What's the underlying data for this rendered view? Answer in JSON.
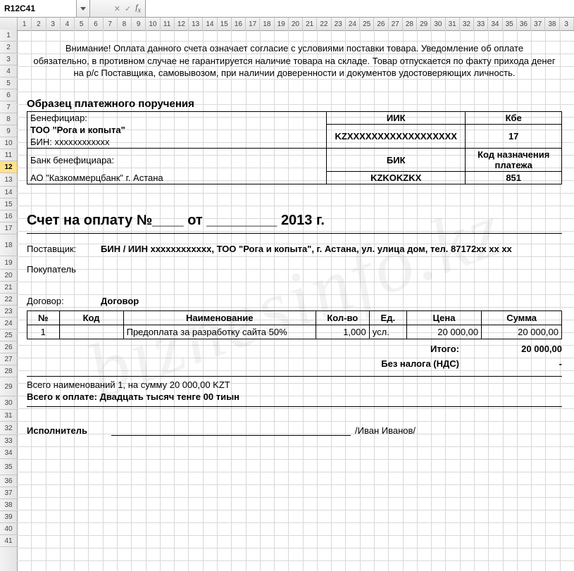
{
  "namebox": "R12C41",
  "formula": "",
  "col_headers": [
    "1",
    "2",
    "3",
    "4",
    "5",
    "6",
    "7",
    "8",
    "9",
    "10",
    "11",
    "12",
    "13",
    "14",
    "15",
    "16",
    "17",
    "18",
    "19",
    "20",
    "21",
    "22",
    "23",
    "24",
    "25",
    "26",
    "27",
    "28",
    "29",
    "30",
    "31",
    "32",
    "33",
    "34",
    "35",
    "36",
    "37",
    "38",
    "3"
  ],
  "row_headers_count": 41,
  "selected_row": 12,
  "warning": {
    "line1": "Внимание! Оплата данного счета означает согласие с условиями поставки товара. Уведомление об оплате",
    "line2": "обязательно, в противном случае не гарантируется наличие товара на складе. Товар отпускается по факту  прихода денег на р/с Поставщика, самовывозом, при наличии доверенности и документов удостоверяющих личность."
  },
  "sample_header": "Образец платежного поручения",
  "bene": {
    "beneficiary_label": "Бенефициар:",
    "iik_label": "ИИК",
    "kbe_label": "Кбе",
    "company": "ТОО \"Рога и копыта\"",
    "iik_value": "KZXXXXXXXXXXXXXXXXXX",
    "kbe_value": "17",
    "bin": "БИН: xxxxxxxxxxxx",
    "bank_label": "Банк бенефициара:",
    "bik_label": "БИК",
    "knp_label": "Код назначения платежа",
    "bank_name": "АО \"Казкоммерцбанк\" г. Астана",
    "bik_value": "KZKOKZKX",
    "knp_value": "851"
  },
  "invoice_title": "Счет на оплату №____  от _________  2013 г.",
  "supplier": {
    "label": "Поставщик:",
    "value": "БИН / ИИН xxxxxxxxxxxx, ТОО \"Рога и копыта\", г. Астана, ул. улица дом, тел. 87172xx xx xx"
  },
  "buyer": {
    "label": "Покупатель",
    "value": ""
  },
  "contract": {
    "label": "Договор:",
    "value": "Договор"
  },
  "items": {
    "head": {
      "no": "№",
      "code": "Код",
      "name": "Наименование",
      "qty": "Кол-во",
      "unit": "Ед.",
      "price": "Цена",
      "sum": "Сумма"
    },
    "rows": [
      {
        "no": "1",
        "code": "",
        "name": "Предоплата за разработку сайта 50%",
        "qty": "1,000",
        "unit": "усл.",
        "price": "20 000,00",
        "sum": "20 000,00"
      }
    ]
  },
  "totals": {
    "itogo_label": "Итого:",
    "itogo_value": "20 000,00",
    "vat_label": "Без налога (НДС)",
    "vat_value": "-",
    "count_line": "Всего наименований 1, на сумму 20 000,00 KZT",
    "words_line": "Всего к оплате: Двадцать тысяч тенге 00 тиын"
  },
  "executor": {
    "label": "Исполнитель",
    "name": "/Иван Иванов/"
  },
  "watermark": "biznesinfo.kz"
}
